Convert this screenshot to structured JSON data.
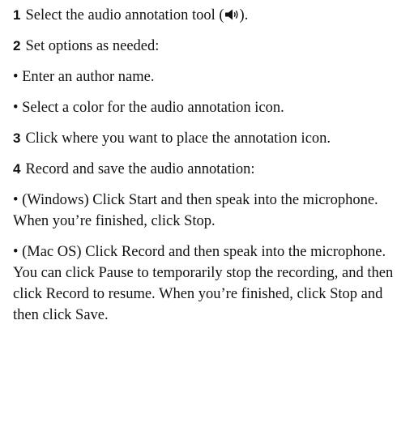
{
  "steps": [
    {
      "number": "1",
      "text_before_icon": "Select the audio annotation tool (",
      "icon": "speaker-icon",
      "text_after_icon": ")."
    },
    {
      "number": "2",
      "text": "Set options as needed:"
    },
    {
      "bullet": "•",
      "text": "Enter an author name."
    },
    {
      "bullet": "•",
      "text": "Select a color for the audio annotation icon."
    },
    {
      "number": "3",
      "text": "Click where you want to place the annotation icon."
    },
    {
      "number": "4",
      "text": "Record and save the audio annotation:"
    },
    {
      "bullet": "•",
      "text": "(Windows) Click Start and then speak into the microphone. When you’re finished, click Stop."
    },
    {
      "bullet": "•",
      "text": "(Mac OS) Click Record and then speak into the microphone. You can click Pause to temporarily stop the recording, and then click Record to resume. When you’re finished, click Stop and then click Save."
    }
  ]
}
